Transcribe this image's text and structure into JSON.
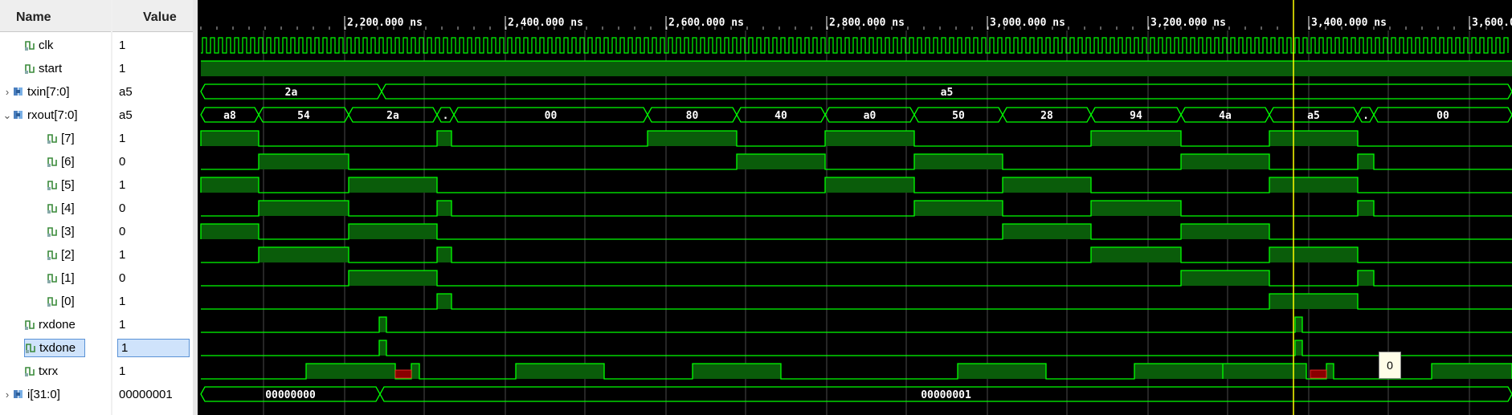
{
  "headers": {
    "name": "Name",
    "value": "Value"
  },
  "timeline": {
    "labels": [
      "2,200.000 ns",
      "2,400.000 ns",
      "2,600.000 ns",
      "2,800.000 ns",
      "3,000.000 ns",
      "3,200.000 ns",
      "3,400.000 ns",
      "3,600.0"
    ]
  },
  "signals": [
    {
      "name": "clk",
      "value": "1",
      "kind": "bit",
      "expander": ""
    },
    {
      "name": "start",
      "value": "1",
      "kind": "bit",
      "expander": ""
    },
    {
      "name": "txin[7:0]",
      "value": "a5",
      "kind": "bus",
      "expander": "›"
    },
    {
      "name": "rxout[7:0]",
      "value": "a5",
      "kind": "bus",
      "expander": "⌄"
    },
    {
      "name": "[7]",
      "value": "1",
      "kind": "bit",
      "expander": ""
    },
    {
      "name": "[6]",
      "value": "0",
      "kind": "bit",
      "expander": ""
    },
    {
      "name": "[5]",
      "value": "1",
      "kind": "bit",
      "expander": ""
    },
    {
      "name": "[4]",
      "value": "0",
      "kind": "bit",
      "expander": ""
    },
    {
      "name": "[3]",
      "value": "0",
      "kind": "bit",
      "expander": ""
    },
    {
      "name": "[2]",
      "value": "1",
      "kind": "bit",
      "expander": ""
    },
    {
      "name": "[1]",
      "value": "0",
      "kind": "bit",
      "expander": ""
    },
    {
      "name": "[0]",
      "value": "1",
      "kind": "bit",
      "expander": ""
    },
    {
      "name": "rxdone",
      "value": "1",
      "kind": "bit",
      "expander": ""
    },
    {
      "name": "txdone",
      "value": "1",
      "kind": "bit",
      "expander": ""
    },
    {
      "name": "txrx",
      "value": "1",
      "kind": "bit",
      "expander": ""
    },
    {
      "name": "i[31:0]",
      "value": "00000001",
      "kind": "bus",
      "expander": "›"
    }
  ],
  "bus_values": {
    "txin": [
      "2a",
      "a5"
    ],
    "rxout": [
      "a8",
      "54",
      "2a",
      ".",
      "00",
      "80",
      "40",
      "a0",
      "50",
      "28",
      "94",
      "4a",
      "a5",
      ".",
      "00"
    ],
    "i": [
      "00000000",
      "00000001"
    ]
  },
  "tooltip": "0",
  "colors": {
    "wave": "#00ff00",
    "fill": "#0a5c0a",
    "cursor": "#ffff00",
    "background": "#000000",
    "grid": "#2e2e2e"
  },
  "icons": {
    "bit": "bit-signal-icon",
    "bus": "bus-signal-icon"
  }
}
